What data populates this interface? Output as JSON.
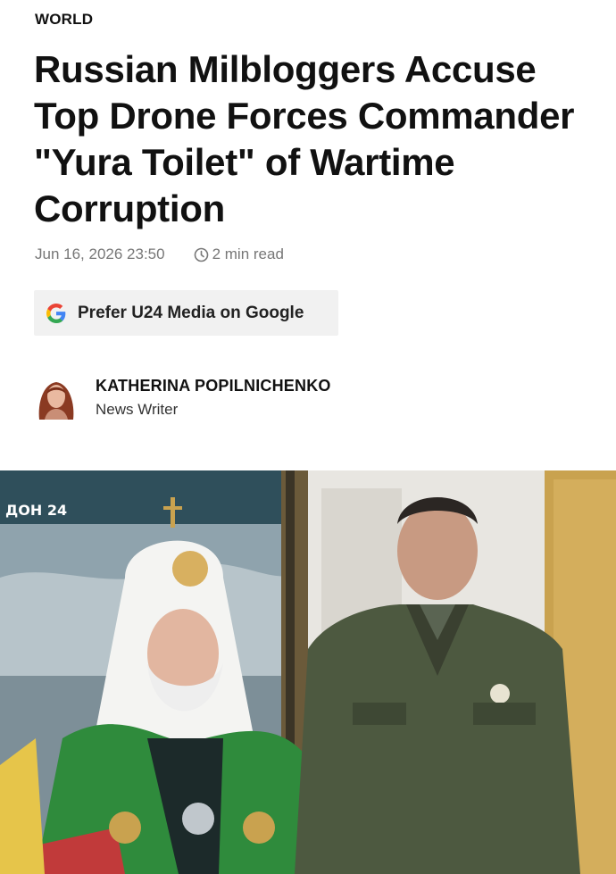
{
  "article": {
    "section": "WORLD",
    "headline": "Russian Milbloggers Accuse Top Drone Forces Commander \"Yura Toilet\" of Wartime Corruption",
    "date": "Jun 16, 2026 23:50",
    "read_time": "2 min read"
  },
  "google_button": {
    "label": "Prefer U24 Media on Google",
    "icon": "google-g-icon"
  },
  "author": {
    "name": "KATHERINA POPILNICHENKO",
    "role": "News Writer"
  },
  "hero_image": {
    "watermark": "ДОН 24"
  },
  "colors": {
    "meta_text": "#777777",
    "button_bg": "#f1f1f1",
    "watermark_red": "#d4212b"
  }
}
